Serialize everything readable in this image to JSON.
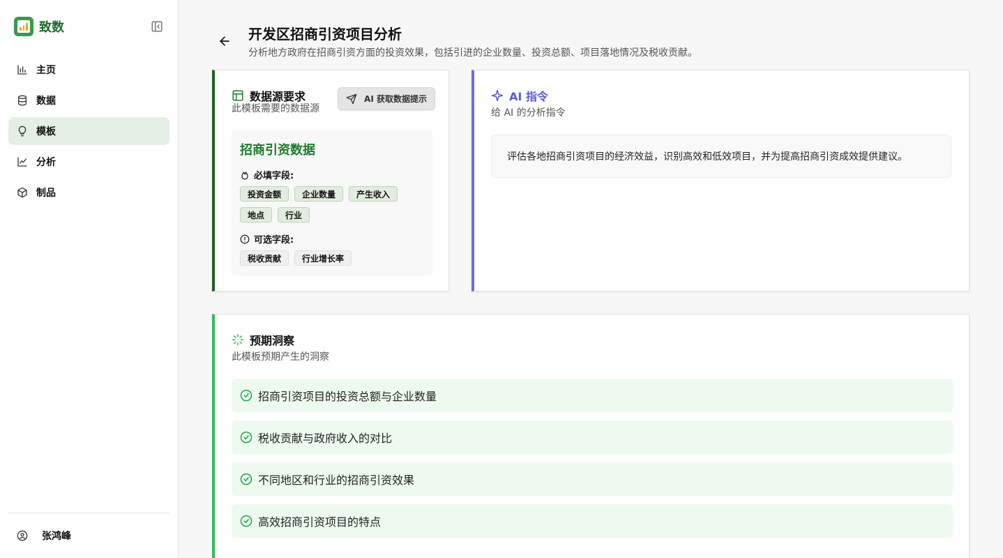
{
  "brand": {
    "name": "致数",
    "logo_icon": "bar-chart-logo",
    "accent": "#3a9a4a"
  },
  "sidebar": {
    "items": [
      {
        "label": "主页",
        "icon": "bar-chart-icon",
        "active": false
      },
      {
        "label": "数据",
        "icon": "database-icon",
        "active": false
      },
      {
        "label": "模板",
        "icon": "lightbulb-icon",
        "active": true
      },
      {
        "label": "分析",
        "icon": "line-chart-icon",
        "active": false
      },
      {
        "label": "制品",
        "icon": "box-icon",
        "active": false
      }
    ],
    "user": {
      "name": "张鸿峰",
      "icon": "user-circle-icon"
    }
  },
  "header": {
    "title": "开发区招商引资项目分析",
    "description": "分析地方政府在招商引资方面的投资效果，包括引进的企业数量、投资总额、项目落地情况及税收贡献。"
  },
  "datasource": {
    "title": "数据源要求",
    "subtitle": "此模板需要的数据源",
    "hint_button": "AI 获取数据提示",
    "source_name": "招商引资数据",
    "required_label": "必填字段:",
    "required_fields": [
      "投资金额",
      "企业数量",
      "产生收入",
      "地点",
      "行业"
    ],
    "optional_label": "可选字段:",
    "optional_fields": [
      "税收贡献",
      "行业增长率"
    ]
  },
  "ai_prompt": {
    "title": "AI 指令",
    "subtitle": "给 AI 的分析指令",
    "text": "评估各地招商引资项目的经济效益，识别高效和低效项目，并为提高招商引资成效提供建议。",
    "accent": "#6d6ddf"
  },
  "insights": {
    "title": "预期洞察",
    "subtitle": "此模板预期产生的洞察",
    "items": [
      "招商引资项目的投资总额与企业数量",
      "税收贡献与政府收入的对比",
      "不同地区和行业的招商引资效果",
      "高效招商引资项目的特点"
    ],
    "accent": "#2fbd5b"
  }
}
